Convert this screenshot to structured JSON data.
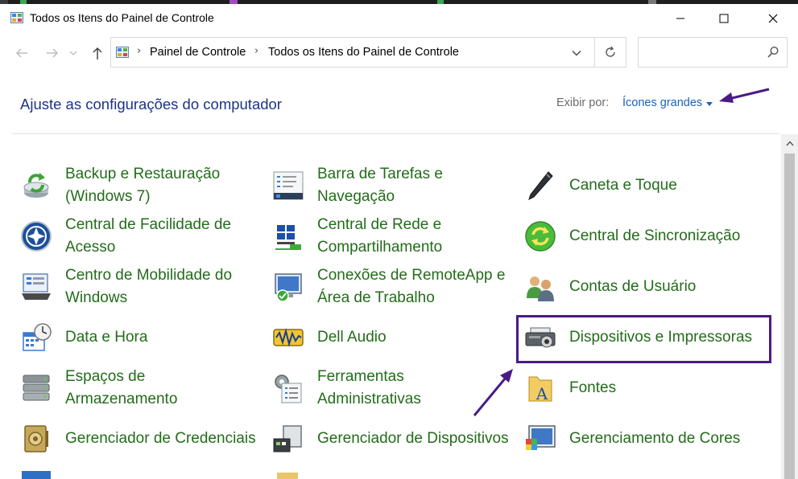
{
  "window": {
    "title": "Todos os Itens do Painel de Controle"
  },
  "address_bar": {
    "crumbs": [
      "Painel de Controle",
      "Todos os Itens do Painel de Controle"
    ],
    "search_value": ""
  },
  "header": {
    "title": "Ajuste as configurações do computador",
    "view_label": "Exibir por:",
    "view_value": "Ícones grandes"
  },
  "items": [
    {
      "label": "Backup e Restauração (Windows 7)",
      "icon": "backup-icon"
    },
    {
      "label": "Barra de Tarefas e Navegação",
      "icon": "taskbar-icon"
    },
    {
      "label": "Caneta e Toque",
      "icon": "pen-icon"
    },
    {
      "label": "Central de Facilidade de Acesso",
      "icon": "ease-of-access-icon"
    },
    {
      "label": "Central de Rede e Compartilhamento",
      "icon": "network-icon"
    },
    {
      "label": "Central de Sincronização",
      "icon": "sync-icon"
    },
    {
      "label": "Centro de Mobilidade do Windows",
      "icon": "mobility-icon"
    },
    {
      "label": "Conexões de RemoteApp e Área de Trabalho",
      "icon": "remoteapp-icon"
    },
    {
      "label": "Contas de Usuário",
      "icon": "user-accounts-icon"
    },
    {
      "label": "Data e Hora",
      "icon": "date-time-icon"
    },
    {
      "label": "Dell Audio",
      "icon": "audio-icon"
    },
    {
      "label": "Dispositivos e Impressoras",
      "icon": "printer-icon"
    },
    {
      "label": "Espaços de Armazenamento",
      "icon": "storage-icon"
    },
    {
      "label": "Ferramentas Administrativas",
      "icon": "admin-tools-icon"
    },
    {
      "label": "Fontes",
      "icon": "fonts-icon"
    },
    {
      "label": "Gerenciador de Credenciais",
      "icon": "credentials-icon"
    },
    {
      "label": "Gerenciador de Dispositivos",
      "icon": "device-manager-icon"
    },
    {
      "label": "Gerenciamento de Cores",
      "icon": "color-management-icon"
    }
  ],
  "colors": {
    "heading": "#1e3287",
    "link_blue": "#1a63b8",
    "item_green": "#236c1a",
    "annotation_purple": "#4a1b86"
  }
}
